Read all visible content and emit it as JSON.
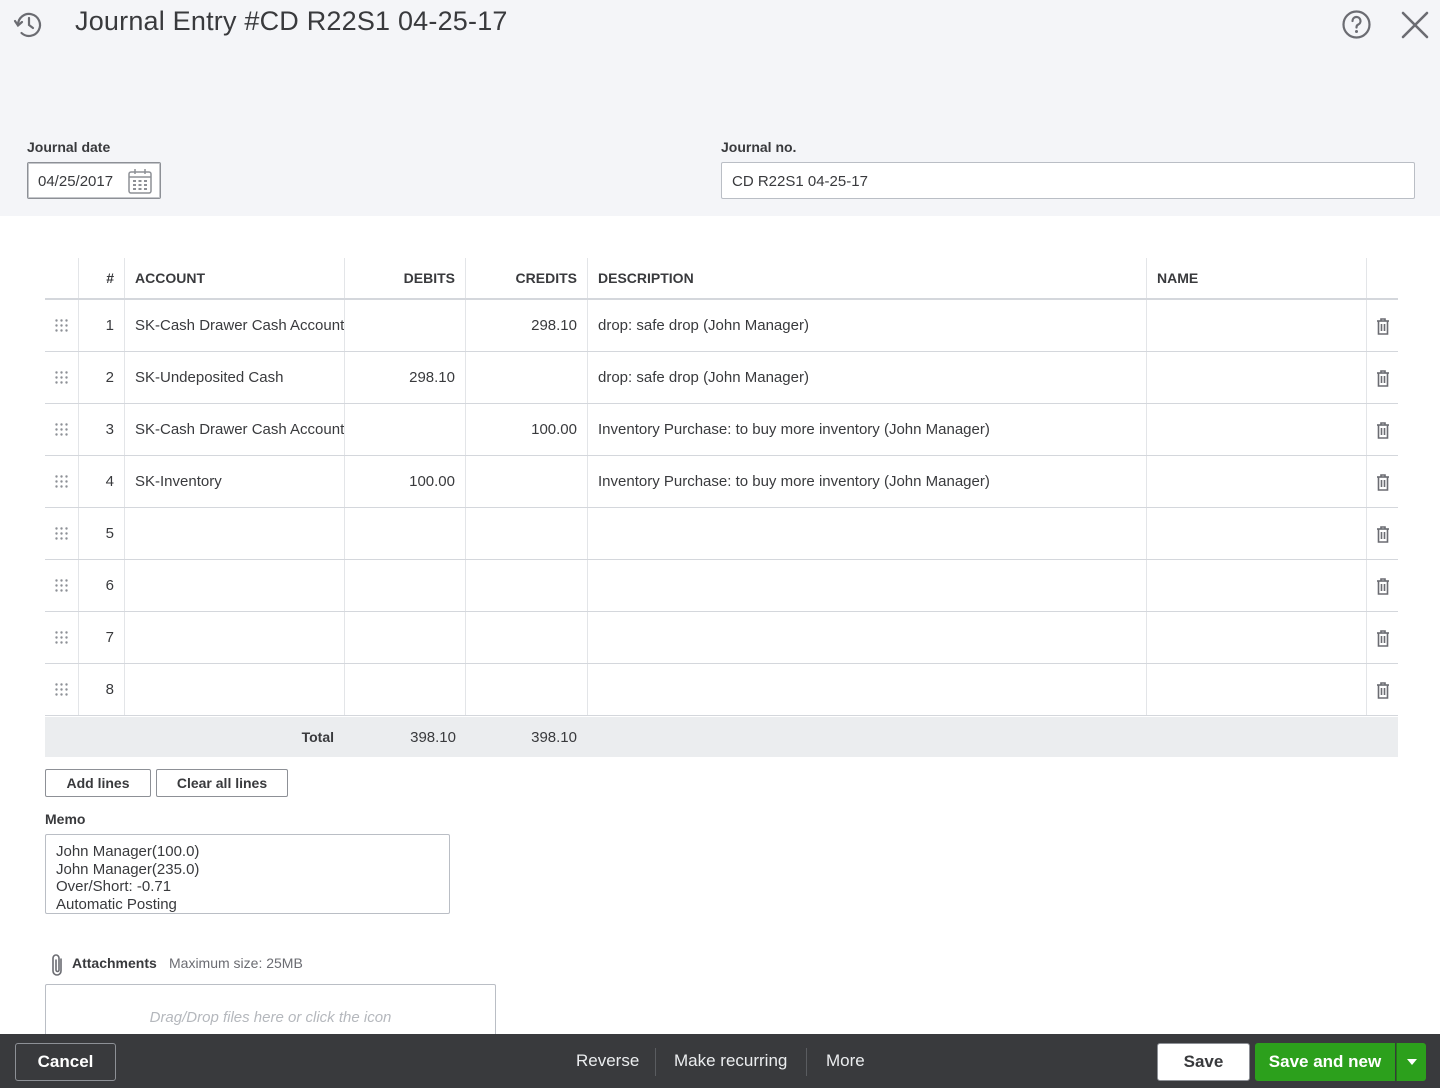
{
  "header": {
    "title": "Journal Entry  #CD R22S1 04-25-17"
  },
  "fields": {
    "journal_date_label": "Journal date",
    "journal_date": "04/25/2017",
    "journal_no_label": "Journal no.",
    "journal_no": "CD R22S1 04-25-17"
  },
  "table": {
    "headers": {
      "num": "#",
      "account": "ACCOUNT",
      "debits": "DEBITS",
      "credits": "CREDITS",
      "description": "DESCRIPTION",
      "name": "NAME"
    },
    "rows": [
      {
        "num": "1",
        "account": "SK-Cash Drawer Cash Account",
        "debits": "",
        "credits": "298.10",
        "description": "drop: safe drop (John Manager)",
        "name": ""
      },
      {
        "num": "2",
        "account": "SK-Undeposited Cash",
        "debits": "298.10",
        "credits": "",
        "description": "drop: safe drop (John Manager)",
        "name": ""
      },
      {
        "num": "3",
        "account": "SK-Cash Drawer Cash Account",
        "debits": "",
        "credits": "100.00",
        "description": "Inventory Purchase: to buy more inventory (John Manager)",
        "name": ""
      },
      {
        "num": "4",
        "account": "SK-Inventory",
        "debits": "100.00",
        "credits": "",
        "description": "Inventory Purchase: to buy more inventory (John Manager)",
        "name": ""
      },
      {
        "num": "5",
        "account": "",
        "debits": "",
        "credits": "",
        "description": "",
        "name": ""
      },
      {
        "num": "6",
        "account": "",
        "debits": "",
        "credits": "",
        "description": "",
        "name": ""
      },
      {
        "num": "7",
        "account": "",
        "debits": "",
        "credits": "",
        "description": "",
        "name": ""
      },
      {
        "num": "8",
        "account": "",
        "debits": "",
        "credits": "",
        "description": "",
        "name": ""
      }
    ],
    "total": {
      "label": "Total",
      "debits": "398.10",
      "credits": "398.10"
    }
  },
  "actions": {
    "add_lines": "Add lines",
    "clear_all_lines": "Clear all lines"
  },
  "memo": {
    "label": "Memo",
    "value": "John Manager(100.0)\nJohn Manager(235.0)\nOver/Short: -0.71\nAutomatic Posting"
  },
  "attachments": {
    "label": "Attachments",
    "max_size": "Maximum size: 25MB",
    "drop_hint": "Drag/Drop files here or click the icon"
  },
  "footer": {
    "cancel": "Cancel",
    "reverse": "Reverse",
    "make_recurring": "Make recurring",
    "more": "More",
    "save": "Save",
    "save_and_new": "Save and new"
  },
  "colors": {
    "primary_green": "#2ca01c",
    "footer_bg": "#393a3d",
    "header_bg": "#f4f5f8"
  }
}
